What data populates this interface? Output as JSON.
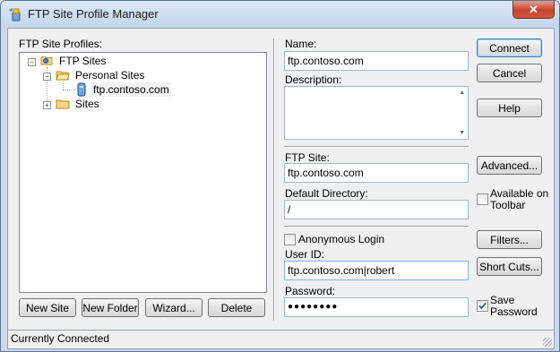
{
  "window": {
    "title": "FTP Site Profile Manager",
    "close_symbol": "✕"
  },
  "profiles": {
    "label": "FTP Site Profiles:",
    "tree": {
      "root": "FTP Sites",
      "personal": "Personal Sites",
      "site_item": "ftp.contoso.com",
      "sites": "Sites"
    },
    "buttons": {
      "new_site": "New Site",
      "new_folder": "New Folder",
      "wizard": "Wizard...",
      "delete": "Delete"
    }
  },
  "form": {
    "name_label": "Name:",
    "name_value": "ftp.contoso.com",
    "description_label": "Description:",
    "description_value": "",
    "ftp_site_label": "FTP Site:",
    "ftp_site_value": "ftp.contoso.com",
    "default_dir_label": "Default Directory:",
    "default_dir_value": "/",
    "anonymous_label": "Anonymous Login",
    "anonymous_checked": false,
    "userid_label": "User ID:",
    "userid_value": "ftp.contoso.com|robert",
    "password_label": "Password:",
    "password_value": "●●●●●●●●"
  },
  "side_buttons": {
    "connect": "Connect",
    "cancel": "Cancel",
    "help": "Help",
    "advanced": "Advanced...",
    "available_toolbar": "Available on Toolbar",
    "available_checked": false,
    "filters": "Filters...",
    "shortcuts": "Short Cuts...",
    "save_password": "Save Password",
    "save_checked": true
  },
  "status": {
    "text": "Currently Connected"
  }
}
